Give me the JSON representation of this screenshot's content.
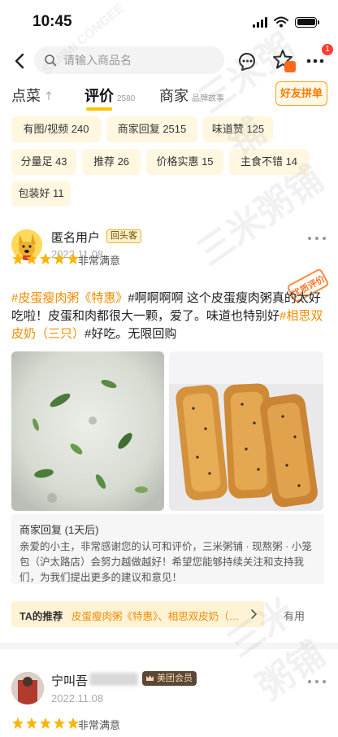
{
  "status_bar": {
    "time": "10:45"
  },
  "search": {
    "placeholder": "请输入商品名"
  },
  "header": {
    "notification_count": "1"
  },
  "tabs": [
    {
      "label": "点菜",
      "sub": ""
    },
    {
      "label": "评价",
      "sub": "2580"
    },
    {
      "label": "商家",
      "sub": "品牌故事"
    }
  ],
  "group_button": "好友拼单",
  "filters": [
    "有图/视频 240",
    "商家回复 2515",
    "味道赞 125",
    "分量足 43",
    "推荐 26",
    "价格实惠 15",
    "主食不错 14",
    "包装好 11"
  ],
  "review": {
    "user": "匿名用户",
    "tag": "回头客",
    "date": "2022.11.08",
    "rating_text": "非常满意",
    "stamp": "优质评价",
    "text_parts": [
      {
        "t": "#皮蛋瘦肉粥《特惠》",
        "hl": true
      },
      {
        "t": "#啊啊啊啊 这个皮蛋瘦肉粥真的太好吃啦！皮蛋和肉都很大一颗，爱了。味道也特别好",
        "hl": false
      },
      {
        "t": "#相思双皮奶（三只）",
        "hl": true
      },
      {
        "t": "#好吃。无限回购",
        "hl": false
      }
    ],
    "reply_title": "商家回复 (1天后)",
    "reply_text": "亲爱的小主，非常感谢您的认可和评价，三米粥铺 · 现熬粥 · 小笼包（沪太路店）会努力越做越好！希望您能够持续关注和支持我们，为我们提出更多的建议和意见！",
    "recommend_key": "TA的推荐",
    "recommend_value": "皮蛋瘦肉粥《特惠》、相思双皮奶（三只）",
    "useful": "有用"
  },
  "review2": {
    "user": "宁叫吾",
    "member_tag": "美团会员",
    "date": "2022.11.08",
    "rating_text": "非常满意"
  },
  "watermark": "三米粥铺",
  "watermark_en": "SANMI CONGEE",
  "colors": {
    "accent": "#ffc300",
    "highlight": "#f08c00",
    "chip_bg": "#fff7e0"
  }
}
